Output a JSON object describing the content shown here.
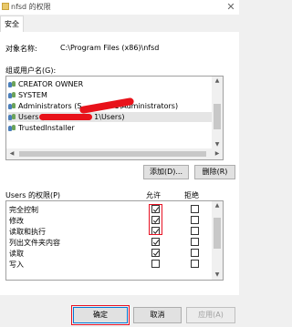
{
  "window": {
    "title": "nfsd 的权限",
    "close_glyph": "✕"
  },
  "tabs": [
    {
      "label": "安全"
    }
  ],
  "object": {
    "label": "对象名称:",
    "value": "C:\\Program Files (x86)\\nfsd"
  },
  "groups": {
    "label": "组或用户名(G):",
    "items": [
      {
        "label": "CREATOR OWNER"
      },
      {
        "label": "SYSTEM"
      },
      {
        "label": "Administrators (S",
        "suffix": "1\\Administrators)"
      },
      {
        "label": "Users (S",
        "suffix": "1\\Users)"
      },
      {
        "label": "TrustedInstaller"
      }
    ],
    "add_button": "添加(D)...",
    "remove_button": "删除(R)"
  },
  "permissions": {
    "header_label": "Users 的权限(P)",
    "allow_header": "允许",
    "deny_header": "拒绝",
    "rows": [
      {
        "name": "完全控制",
        "allow": true,
        "deny": false
      },
      {
        "name": "修改",
        "allow": true,
        "deny": false
      },
      {
        "name": "读取和执行",
        "allow": true,
        "deny": false
      },
      {
        "name": "列出文件夹内容",
        "allow": true,
        "deny": false
      },
      {
        "name": "读取",
        "allow": true,
        "deny": false
      },
      {
        "name": "写入",
        "allow": false,
        "deny": false
      }
    ]
  },
  "footer": {
    "ok": "确定",
    "cancel": "取消",
    "apply": "应用(A)"
  },
  "colors": {
    "highlight": "#e81123",
    "redaction": "#e8121a",
    "accent": "#0078d7"
  }
}
